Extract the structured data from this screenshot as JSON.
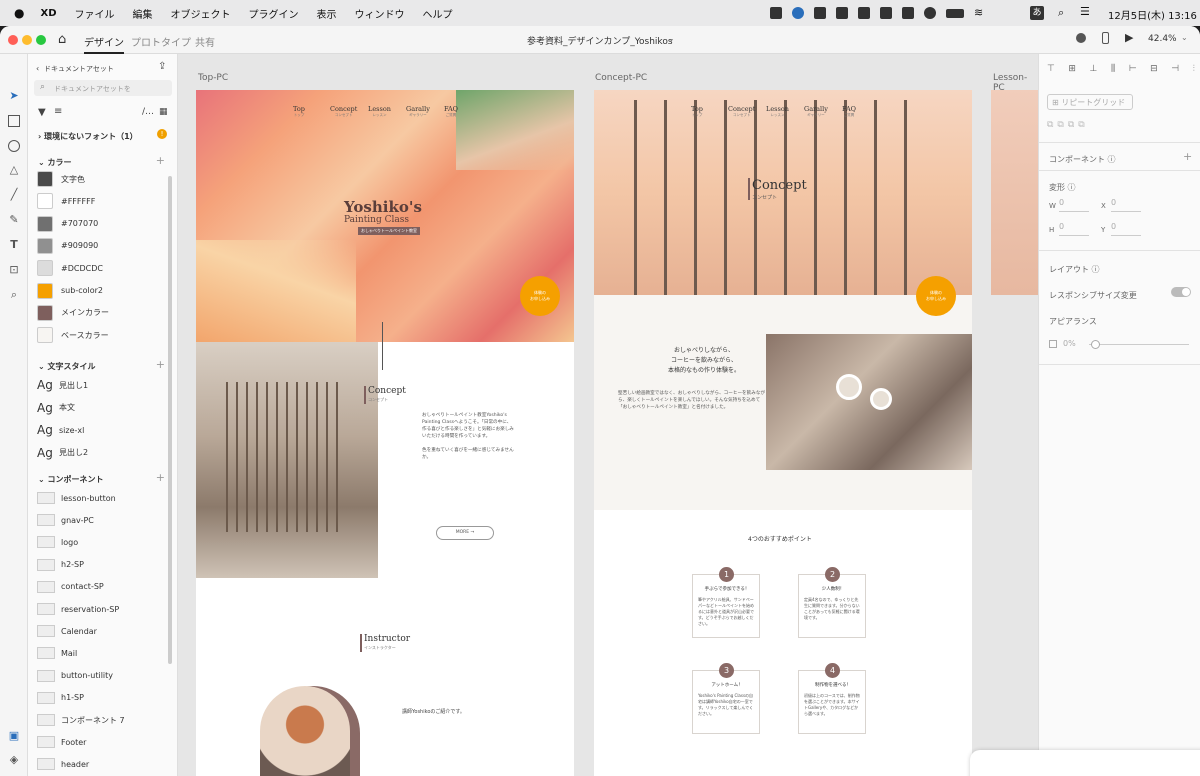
{
  "menubar": {
    "apple": "",
    "app": "XD",
    "items": [
      "ファイル",
      "編集",
      "オブジェクト",
      "プラグイン",
      "表示",
      "ウィンドウ",
      "ヘルプ"
    ],
    "input_mode": "あ",
    "datetime": "12月5日(木)  13:16"
  },
  "window": {
    "tabs": [
      "デザイン",
      "プロトタイプ",
      "共有"
    ],
    "doc_title": "参考資料_デザインカンプ_Yoshikos",
    "zoom": "42.4%"
  },
  "assets": {
    "header": "ドキュメントアセット",
    "search_placeholder": "ドキュメントアセットを",
    "missing_fonts": "環境にないフォント（1）",
    "colors_title": "カラー",
    "colors": [
      {
        "name": "文字色",
        "hex": "#4a4a4a"
      },
      {
        "name": "#FFFFFF",
        "hex": "#FFFFFF"
      },
      {
        "name": "#707070",
        "hex": "#707070"
      },
      {
        "name": "#909090",
        "hex": "#909090"
      },
      {
        "name": "#DCDCDC",
        "hex": "#DCDCDC"
      },
      {
        "name": "sub-color2",
        "hex": "#F5A000"
      },
      {
        "name": "メインカラー",
        "hex": "#7E5F5D"
      },
      {
        "name": "ベースカラー",
        "hex": "#F7F5F2"
      }
    ],
    "text_title": "文字スタイル",
    "text_styles": [
      "見出し1",
      "本文",
      "size-xl",
      "見出し2"
    ],
    "comp_title": "コンポーネント",
    "components": [
      "lesson-button",
      "gnav-PC",
      "logo",
      "h2-SP",
      "contact-SP",
      "reservation-SP",
      "Calendar",
      "Mail",
      "button-utility",
      "h1-SP",
      "コンポーネント 7",
      "Footer",
      "header"
    ]
  },
  "artboards": {
    "top": "Top-PC",
    "concept": "Concept-PC",
    "lesson": "Lesson-PC"
  },
  "site": {
    "nav": [
      "Top",
      "Concept",
      "Lesson",
      "Garally",
      "FAQ"
    ],
    "nav_sub": [
      "トップ",
      "コンセプト",
      "レッスン",
      "ギャラリー",
      "ご質問"
    ],
    "logo1": "Yoshiko's",
    "logo2": "Painting Class",
    "logo_sub": "おしゃべりトールペイント教室",
    "cta": "体験の\nお申し込み",
    "concept": "Concept",
    "concept_sub": "コンセプト",
    "instructor": "Instructor",
    "instructor_sub": "インストラクター",
    "more": "MORE",
    "intro_line": "講師Yoshikoのご紹介です。",
    "top_para": "おしゃべりトールペイント教室Yoshiko's Painting Classへようこそ。「日常の中に、作る喜びと作る楽しさを」と気軽にお楽しみいただける時間を作っています。",
    "top_para2": "色を重ねていく喜びを一緒に感じてみませんか。",
    "concept_lead": [
      "おしゃべりしながら、",
      "コーヒーを飲みながら、",
      "本格的なもの作り体験を。"
    ],
    "concept_para": "堅苦しい絵画教室ではなく、おしゃべりしながら、コーヒーを飲みながら、楽しくトールペイントを楽しんでほしい。そんな気持ちを込めて「おしゃべりトールペイント教室」と名付けました。",
    "points_title": "4つのおすすめポイント",
    "points": [
      {
        "n": "1",
        "t": "手ぶらで参加できる！",
        "d": "筆やアクリル絵具、サンドペーパーなどトールペイントを始めるには意外と道具が沢山必要です。どうぞ手ぶらでお越しください。"
      },
      {
        "n": "2",
        "t": "少人数制！",
        "d": "定員4名なので、ゆっくりと先生に質問できます。分からないことがあっても気軽に聞ける環境です。"
      },
      {
        "n": "3",
        "t": "アットホーム！",
        "d": "Yoshiko's Painting Classの自宅は講師Yoshiko自宅の一室です。リラックスして楽しんでください。"
      },
      {
        "n": "4",
        "t": "制作物を選べる！",
        "d": "初級は上のコースでは、制作物を選ぶことができます。本サイトGalleryや、カタログなどから選べます。"
      }
    ]
  },
  "props": {
    "repeat_grid": "リピートグリッド",
    "component": "コンポーネント",
    "transform": "変形",
    "W": "0",
    "H": "0",
    "X": "0",
    "Y": "0",
    "layout": "レイアウト",
    "responsive": "レスポンシブサイズ変更",
    "appearance": "アピアランス",
    "opacity": "0%"
  }
}
